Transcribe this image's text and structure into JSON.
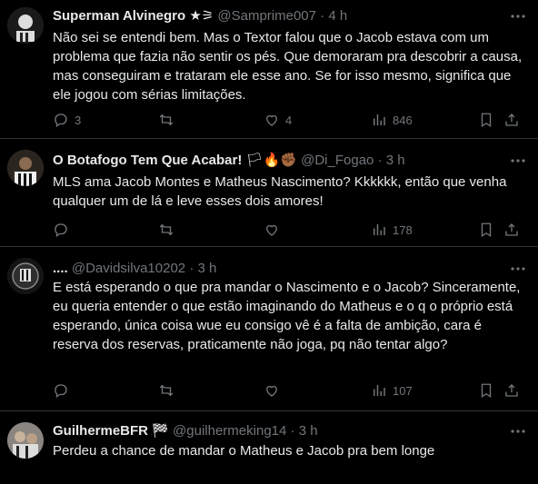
{
  "tweets": [
    {
      "name": "Superman Alvinegro",
      "badge": "★⚞",
      "handle": "@Samprime007",
      "sep": "·",
      "time": "4 h",
      "text": "Não sei se entendi bem. Mas o Textor falou que o Jacob estava com um problema que fazia não sentir os pés. Que demoraram pra descobrir a causa, mas conseguiram e trataram ele esse ano. Se for isso mesmo, significa que ele jogou com sérias limitações.",
      "replies": "3",
      "retweets": "",
      "likes": "4",
      "views": "846",
      "avatar_color": "#3a3a3a"
    },
    {
      "name": "O Botafogo Tem Que Acabar!",
      "badge": "🏳🔥✊🏾",
      "handle": "@Di_Fogao",
      "sep": "·",
      "time": "3 h",
      "text": "MLS ama Jacob Montes e Matheus Nascimento? Kkkkkk, então que venha qualquer um de lá e leve esses dois amores!",
      "replies": "",
      "retweets": "",
      "likes": "",
      "views": "178",
      "avatar_color": "#5a4a3a"
    },
    {
      "name": "....",
      "badge": "",
      "handle": "@Davidsilva10202",
      "sep": "·",
      "time": "3 h",
      "text": "E está esperando o que pra mandar o Nascimento e o Jacob? Sinceramente, eu queria entender o que estão imaginando do Matheus e o q o próprio está esperando, única coisa wue eu consigo vê é a falta de ambição, cara é reserva dos reservas, praticamente não joga, pq não tentar algo?",
      "replies": "",
      "retweets": "",
      "likes": "",
      "views": "107",
      "avatar_color": "#2a2a2a"
    },
    {
      "name": "GuilhermeBFR",
      "badge": "🏁",
      "handle": "@guilhermeking14",
      "sep": "·",
      "time": "3 h",
      "text": "Perdeu a chance de mandar o Matheus e Jacob pra bem longe",
      "replies": "",
      "retweets": "",
      "likes": "",
      "views": "",
      "avatar_color": "#6a6a6a"
    }
  ],
  "icons": {
    "reply": "reply-icon",
    "retweet": "retweet-icon",
    "like": "heart-icon",
    "views": "views-chart-icon",
    "bookmark": "bookmark-icon",
    "share": "share-icon",
    "more": "more-icon"
  }
}
